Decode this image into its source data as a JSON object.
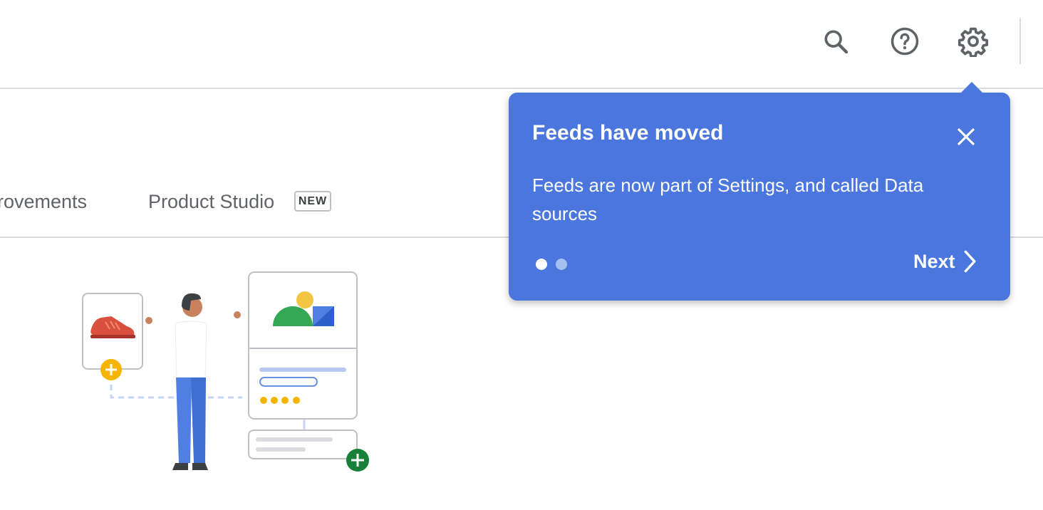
{
  "header": {
    "icons": [
      "search-icon",
      "help-icon",
      "settings-icon"
    ]
  },
  "tabs": [
    {
      "label": "rovements"
    },
    {
      "label": "Product Studio",
      "badge": "NEW"
    }
  ],
  "popover": {
    "title": "Feeds have moved",
    "body": "Feeds are now part of Settings, and called Data sources",
    "next_label": "Next",
    "pages": 2,
    "current_page": 1
  },
  "colors": {
    "popover_bg": "#4a76dd",
    "icon_gray": "#5f6368"
  }
}
